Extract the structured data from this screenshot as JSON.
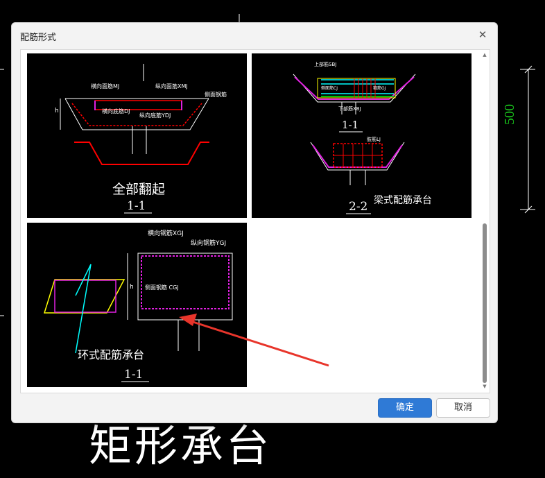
{
  "background": {
    "dimension_label": "500",
    "big_title": "矩形承台"
  },
  "dialog": {
    "title": "配筋形式",
    "close_glyph": "✕",
    "ok_label": "确定",
    "cancel_label": "取消"
  },
  "thumbnails": [
    {
      "caption": "全部翻起",
      "section": "1-1",
      "labels": {
        "top_transverse": "横向面筋MJ",
        "top_longitudinal": "纵向面筋XMJ",
        "bottom_transverse": "横向底筋DJ",
        "bottom_longitudinal": "纵向底筋YDJ",
        "side": "侧面钢筋",
        "h": "h"
      }
    },
    {
      "caption": "梁式配筋承台",
      "section_top": "1-1",
      "section_bottom": "2-2",
      "labels": {
        "top": "上部筋SBJ",
        "bottom": "下部筋XBJ",
        "side": "侧面筋CJ",
        "stirrup": "箍筋GJ",
        "leg": "肢筋LJ"
      }
    },
    {
      "caption": "环式配筋承台",
      "section": "1-1",
      "labels": {
        "transverse": "横向钢筋XGJ",
        "longitudinal": "纵向钢筋YGJ",
        "side": "侧面钢筋 CGJ",
        "h": "h"
      }
    }
  ],
  "colors": {
    "accent_button": "#2f7ad6",
    "cad_background": "#000000",
    "pointer_arrow": "#e8352b"
  }
}
